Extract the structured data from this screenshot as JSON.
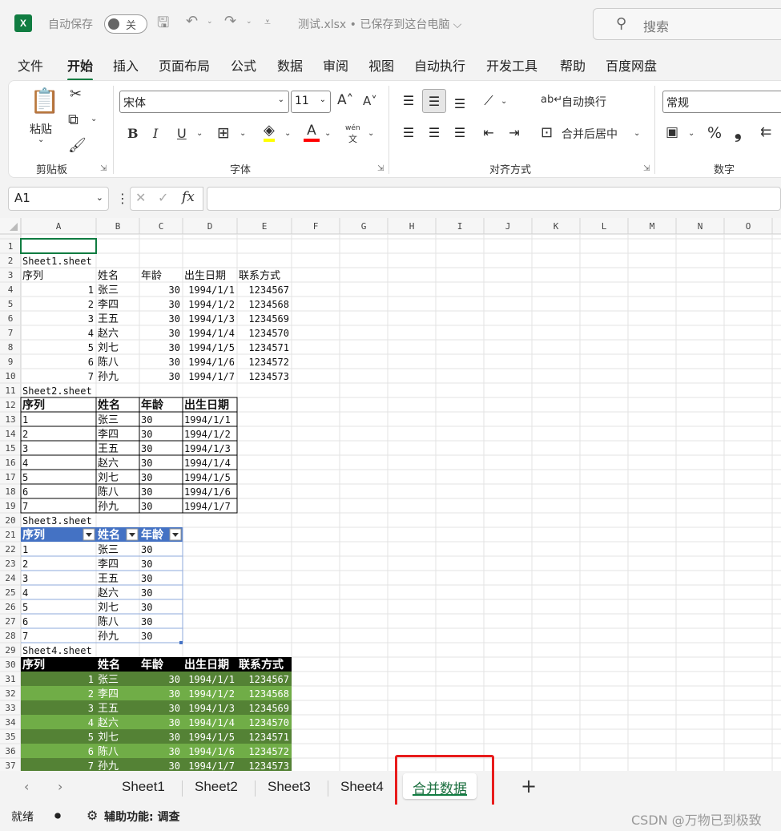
{
  "titlebar": {
    "logo": "X",
    "autosave_label": "自动保存",
    "autosave_state": "关",
    "save_glyph": "🖫",
    "undo_glyph": "↶",
    "redo_glyph": "↷",
    "caret_glyph": "⌄",
    "customize_glyph": "⩡",
    "document_title": "测试.xlsx • 已保存到这台电脑 ⌵",
    "search_glyph": "⚲",
    "search_placeholder": "搜索"
  },
  "ribbon_tabs": [
    "文件",
    "开始",
    "插入",
    "页面布局",
    "公式",
    "数据",
    "审阅",
    "视图",
    "自动执行",
    "开发工具",
    "帮助",
    "百度网盘"
  ],
  "active_ribbon_tab": "开始",
  "ribbon": {
    "clipboard": {
      "paste_glyph": "📋",
      "paste": "粘贴",
      "cut_glyph": "✂",
      "copy_glyph": "⧉",
      "painter_glyph": "🖌",
      "caret": "⌄",
      "group": "剪贴板"
    },
    "font": {
      "name": "宋体",
      "size": "11",
      "grow": "A˄",
      "shrink": "A˅",
      "bold": "B",
      "italic": "I",
      "underline": "U",
      "border_glyph": "⊞",
      "fill_glyph": "◈",
      "color_glyph": "A",
      "wen_top": "wén",
      "wen_bottom": "文",
      "group": "字体"
    },
    "alignment": {
      "wrap": "自动换行",
      "merge": "合并后居中",
      "top_glyph": "☰",
      "middle_glyph": "☰",
      "bottom_glyph": "☰",
      "orient_glyph": "⟋",
      "left_glyph": "☰",
      "center_glyph": "☰",
      "right_glyph": "☰",
      "outdent_glyph": "⇤",
      "indent_glyph": "⇥",
      "wrap_glyph": "ab↵",
      "merge_glyph": "⊡",
      "group": "对齐方式"
    },
    "number": {
      "format": "常规",
      "currency_glyph": "▣",
      "percent": "%",
      "comma": "❟",
      "decimal": "⇇",
      "group": "数字"
    },
    "launcher_glyph": "⇲"
  },
  "formula_bar": {
    "name_box": "A1",
    "caret": "⌄",
    "dots": "⋮",
    "cancel_glyph": "✕",
    "enter_glyph": "✓",
    "fx": "fx",
    "formula": ""
  },
  "columns": [
    "A",
    "B",
    "C",
    "D",
    "E",
    "F",
    "G",
    "H",
    "I",
    "J",
    "K",
    "L",
    "M",
    "N",
    "O"
  ],
  "row_numbers": [
    "1",
    "2",
    "3",
    "4",
    "5",
    "6",
    "7",
    "8",
    "9",
    "10",
    "11",
    "12",
    "13",
    "14",
    "15",
    "16",
    "17",
    "18",
    "19",
    "20",
    "21",
    "22",
    "23",
    "24",
    "25",
    "26",
    "27",
    "28",
    "29",
    "30",
    "31",
    "32",
    "33",
    "34",
    "35",
    "36",
    "37"
  ],
  "sheet1": {
    "title": "Sheet1.sheet",
    "headers": [
      "序列",
      "姓名",
      "年龄",
      "出生日期",
      "联系方式"
    ],
    "rows": [
      [
        "1",
        "张三",
        "30",
        "1994/1/1",
        "1234567"
      ],
      [
        "2",
        "李四",
        "30",
        "1994/1/2",
        "1234568"
      ],
      [
        "3",
        "王五",
        "30",
        "1994/1/3",
        "1234569"
      ],
      [
        "4",
        "赵六",
        "30",
        "1994/1/4",
        "1234570"
      ],
      [
        "5",
        "刘七",
        "30",
        "1994/1/5",
        "1234571"
      ],
      [
        "6",
        "陈八",
        "30",
        "1994/1/6",
        "1234572"
      ],
      [
        "7",
        "孙九",
        "30",
        "1994/1/7",
        "1234573"
      ]
    ]
  },
  "sheet2": {
    "title": "Sheet2.sheet",
    "headers": [
      "序列",
      "姓名",
      "年龄",
      "出生日期"
    ],
    "rows": [
      [
        "1",
        "张三",
        "30",
        "1994/1/1"
      ],
      [
        "2",
        "李四",
        "30",
        "1994/1/2"
      ],
      [
        "3",
        "王五",
        "30",
        "1994/1/3"
      ],
      [
        "4",
        "赵六",
        "30",
        "1994/1/4"
      ],
      [
        "5",
        "刘七",
        "30",
        "1994/1/5"
      ],
      [
        "6",
        "陈八",
        "30",
        "1994/1/6"
      ],
      [
        "7",
        "孙九",
        "30",
        "1994/1/7"
      ]
    ]
  },
  "sheet3": {
    "title": "Sheet3.sheet",
    "headers": [
      "序列",
      "姓名",
      "年龄"
    ],
    "rows": [
      [
        "1",
        "张三",
        "30"
      ],
      [
        "2",
        "李四",
        "30"
      ],
      [
        "3",
        "王五",
        "30"
      ],
      [
        "4",
        "赵六",
        "30"
      ],
      [
        "5",
        "刘七",
        "30"
      ],
      [
        "6",
        "陈八",
        "30"
      ],
      [
        "7",
        "孙九",
        "30"
      ]
    ]
  },
  "sheet4": {
    "title": "Sheet4.sheet",
    "headers": [
      "序列",
      "姓名",
      "年龄",
      "出生日期",
      "联系方式"
    ],
    "rows": [
      [
        "1",
        "张三",
        "30",
        "1994/1/1",
        "1234567"
      ],
      [
        "2",
        "李四",
        "30",
        "1994/1/2",
        "1234568"
      ],
      [
        "3",
        "王五",
        "30",
        "1994/1/3",
        "1234569"
      ],
      [
        "4",
        "赵六",
        "30",
        "1994/1/4",
        "1234570"
      ],
      [
        "5",
        "刘七",
        "30",
        "1994/1/5",
        "1234571"
      ],
      [
        "6",
        "陈八",
        "30",
        "1994/1/6",
        "1234572"
      ],
      [
        "7",
        "孙九",
        "30",
        "1994/1/7",
        "1234573"
      ]
    ]
  },
  "sheet_tabs": [
    "Sheet1",
    "Sheet2",
    "Sheet3",
    "Sheet4",
    "合并数据"
  ],
  "active_sheet_tab": "合并数据",
  "sheet_nav": {
    "prev": "‹",
    "next": "›",
    "add": "+"
  },
  "status": {
    "ready": "就绪",
    "macro_glyph": "⏺",
    "accessibility_glyph": "⚙",
    "accessibility": "辅助功能: 调查",
    "watermark": "CSDN @万物已到极致"
  },
  "colors": {
    "excel_green": "#107c41",
    "table_header_blue": "#4472c4",
    "table_border_blue": "#8ea9db",
    "green_dark": "#548235",
    "green_light": "#70ad47",
    "highlight_red": "#e81c1c",
    "font_color_red": "#ff0000",
    "fill_yellow": "#ffff00"
  }
}
